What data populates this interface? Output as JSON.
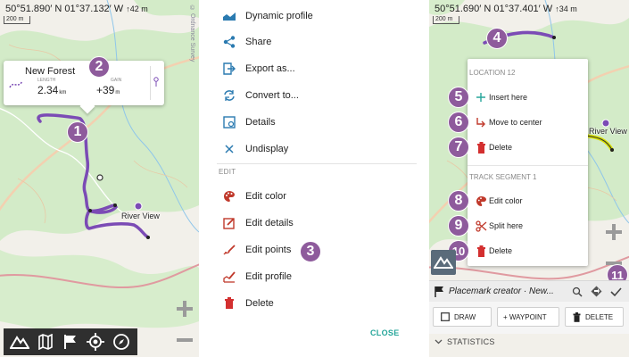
{
  "left": {
    "coords": "50°51.890′ N 01°37.132′ W",
    "altitude": "↑42 m",
    "scale": "200 m",
    "credit": "© Ordnance Survey",
    "popup": {
      "title": "New Forest",
      "length_label": "LENGTH",
      "length_value": "2.34",
      "length_unit": "km",
      "gain_label": "GAIN",
      "gain_value": "+39",
      "gain_unit": "m"
    },
    "place_label": "River View",
    "badges": [
      "1",
      "2"
    ],
    "toolbar": [
      "app-logo-icon",
      "map-icon",
      "flag-icon",
      "locate-icon",
      "compass-icon"
    ]
  },
  "middle": {
    "items_top": [
      {
        "label": "Dynamic profile",
        "icon": "profile-chart-icon"
      },
      {
        "label": "Share",
        "icon": "share-icon"
      },
      {
        "label": "Export as...",
        "icon": "export-icon"
      },
      {
        "label": "Convert to...",
        "icon": "convert-icon"
      },
      {
        "label": "Details",
        "icon": "details-icon"
      },
      {
        "label": "Undisplay",
        "icon": "close-x-icon"
      }
    ],
    "section_edit": "EDIT",
    "items_edit": [
      {
        "label": "Edit color",
        "icon": "palette-icon"
      },
      {
        "label": "Edit details",
        "icon": "edit-details-icon"
      },
      {
        "label": "Edit points",
        "icon": "edit-points-icon"
      },
      {
        "label": "Edit profile",
        "icon": "edit-profile-icon"
      },
      {
        "label": "Delete",
        "icon": "trash-icon"
      }
    ],
    "badge": "3",
    "close_label": "CLOSE"
  },
  "right": {
    "coords": "50°51.690′ N 01°37.401′ W",
    "altitude": "↑34 m",
    "scale": "200 m",
    "place_label": "River View",
    "context_menu": {
      "section1": "LOCATION 12",
      "items1": [
        {
          "label": "Insert here",
          "icon": "plus-icon",
          "badge": "5"
        },
        {
          "label": "Move to center",
          "icon": "move-center-icon",
          "badge": "6"
        },
        {
          "label": "Delete",
          "icon": "trash-icon",
          "badge": "7"
        }
      ],
      "section2": "TRACK SEGMENT 1",
      "items2": [
        {
          "label": "Edit color",
          "icon": "palette-icon",
          "badge": "8"
        },
        {
          "label": "Split here",
          "icon": "scissors-icon",
          "badge": "9"
        },
        {
          "label": "Delete",
          "icon": "trash-icon",
          "badge": "10"
        }
      ]
    },
    "badge_top": "4",
    "badge_confirm": "11",
    "placemark_title": "Placemark creator · New...",
    "buttons": [
      {
        "label": "DRAW",
        "icon": "checkbox-icon"
      },
      {
        "label": "+ WAYPOINT",
        "icon": "plus-icon"
      },
      {
        "label": "DELETE",
        "icon": "trash-icon"
      }
    ],
    "statistics_label": "STATISTICS"
  },
  "colors": {
    "track": "#7b4bb5",
    "track_highlight": "#d8e000",
    "badge": "#8e5b9c",
    "delete_red": "#d32f2f",
    "accent_teal": "#26a69a",
    "map_green": "#cde8c5"
  }
}
